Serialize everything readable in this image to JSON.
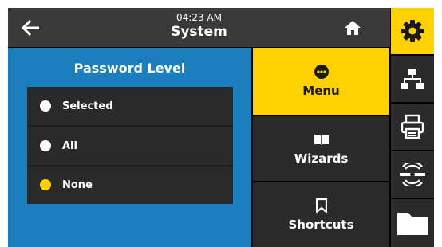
{
  "header": {
    "time": "04:23 AM",
    "title": "System",
    "back_icon": "arrow-left-icon",
    "home_icon": "home-icon"
  },
  "password_panel": {
    "title": "Password Level",
    "options": [
      {
        "label": "Selected",
        "selected": false
      },
      {
        "label": "All",
        "selected": false
      },
      {
        "label": "None",
        "selected": true
      }
    ]
  },
  "menu_column": [
    {
      "label": "Menu",
      "icon": "dots-icon",
      "active": true
    },
    {
      "label": "Wizards",
      "icon": "book-icon",
      "active": false
    },
    {
      "label": "Shortcuts",
      "icon": "bookmark-icon",
      "active": false
    }
  ],
  "rail": [
    {
      "name": "settings",
      "icon": "gear-icon",
      "active": true
    },
    {
      "name": "network",
      "icon": "network-icon",
      "active": false
    },
    {
      "name": "print",
      "icon": "printer-icon",
      "active": false
    },
    {
      "name": "sensor",
      "icon": "sensor-icon",
      "active": false
    },
    {
      "name": "storage",
      "icon": "folder-icon",
      "active": false
    }
  ],
  "colors": {
    "accent_yellow": "#ffd100",
    "panel_blue": "#1b7fbd",
    "dark_bg": "#2a2a2a"
  }
}
